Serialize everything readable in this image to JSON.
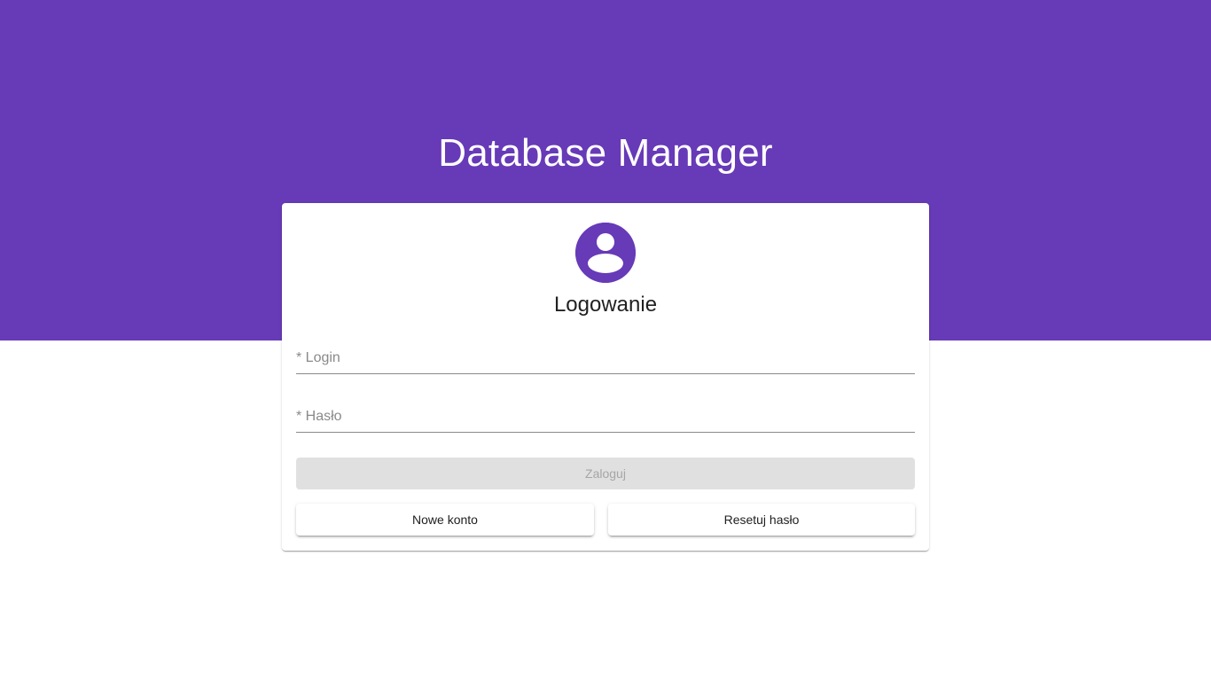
{
  "app": {
    "title": "Database Manager",
    "accent_color": "#673ab7"
  },
  "login_card": {
    "avatar_icon": "account-circle-icon",
    "title": "Logowanie",
    "fields": {
      "login": {
        "placeholder": "* Login",
        "value": ""
      },
      "password": {
        "placeholder": "* Hasło",
        "value": ""
      }
    },
    "buttons": {
      "submit": {
        "label": "Zaloguj",
        "disabled": true
      },
      "new_account": {
        "label": "Nowe konto"
      },
      "reset_password": {
        "label": "Resetuj hasło"
      }
    }
  }
}
